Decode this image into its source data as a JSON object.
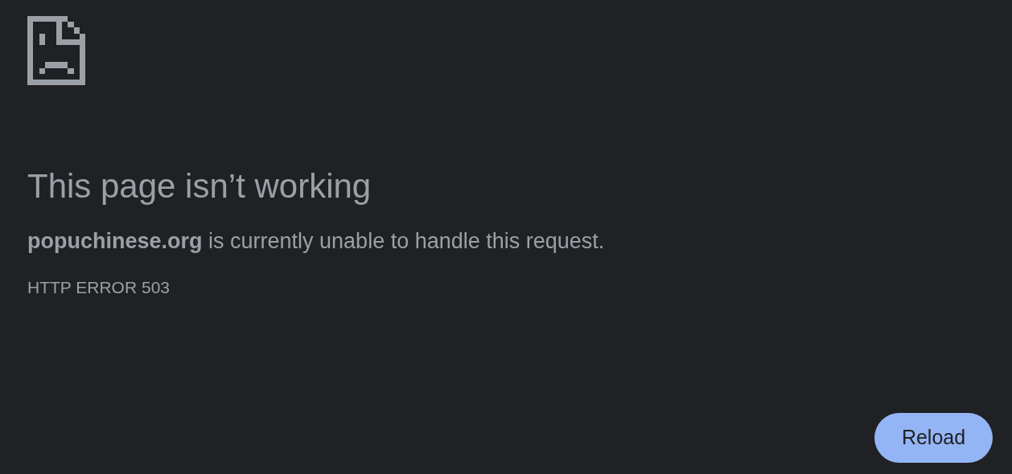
{
  "heading": "This page isn’t working",
  "message": "**popuchinese.org** is currently unable to handle this request.",
  "error_code": "HTTP ERROR 503",
  "button": {
    "label": "Reload"
  }
}
